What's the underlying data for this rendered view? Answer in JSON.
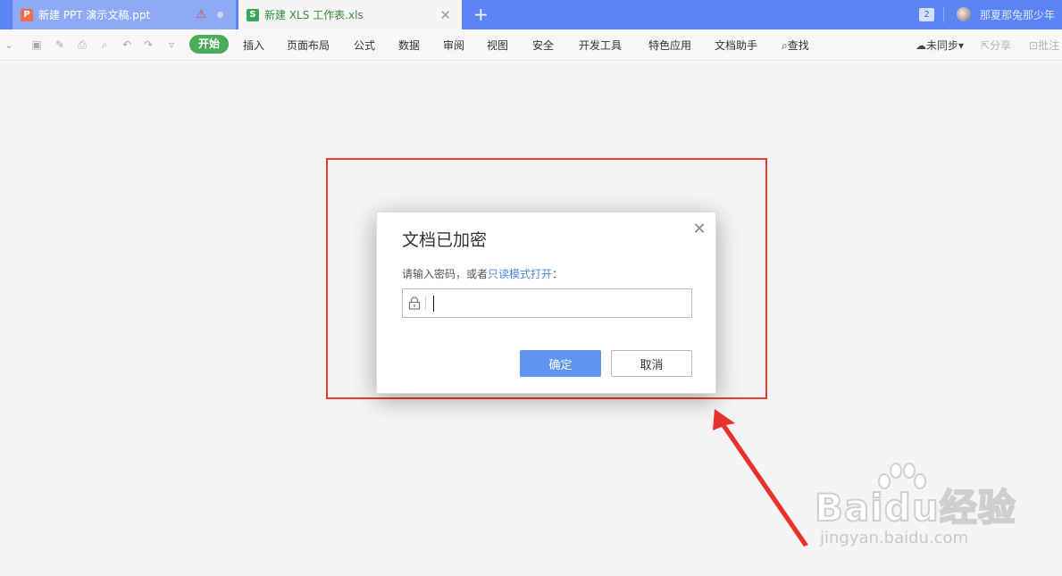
{
  "tabs": [
    {
      "title": "新建 PPT 演示文稿.ppt",
      "icon": "ppt-icon",
      "icon_glyph": "P"
    },
    {
      "title": "新建 XLS 工作表.xls",
      "icon": "xls-icon",
      "icon_glyph": "S"
    }
  ],
  "tabbar": {
    "new_tab": "+",
    "window_count": "2",
    "user_name": "那夏那兔那少年"
  },
  "menubar": {
    "items": [
      "开始",
      "插入",
      "页面布局",
      "公式",
      "数据",
      "审阅",
      "视图",
      "安全",
      "开发工具",
      "特色应用",
      "文档助手",
      "查找"
    ],
    "sync": "未同步",
    "share": "分享",
    "annotate": "批注"
  },
  "dialog": {
    "title": "文档已加密",
    "prompt_before": "请输入密码，或者",
    "prompt_link": "只读模式打开",
    "prompt_after": "：",
    "password_value": "",
    "ok_label": "确定",
    "cancel_label": "取消"
  },
  "watermark": {
    "logo": "Baidu经验",
    "url": "jingyan.baidu.com"
  },
  "colors": {
    "tabbar": "#5b85f5",
    "accent_green": "#4aac58",
    "primary_button": "#5d95f0",
    "highlight": "#e93a33"
  }
}
